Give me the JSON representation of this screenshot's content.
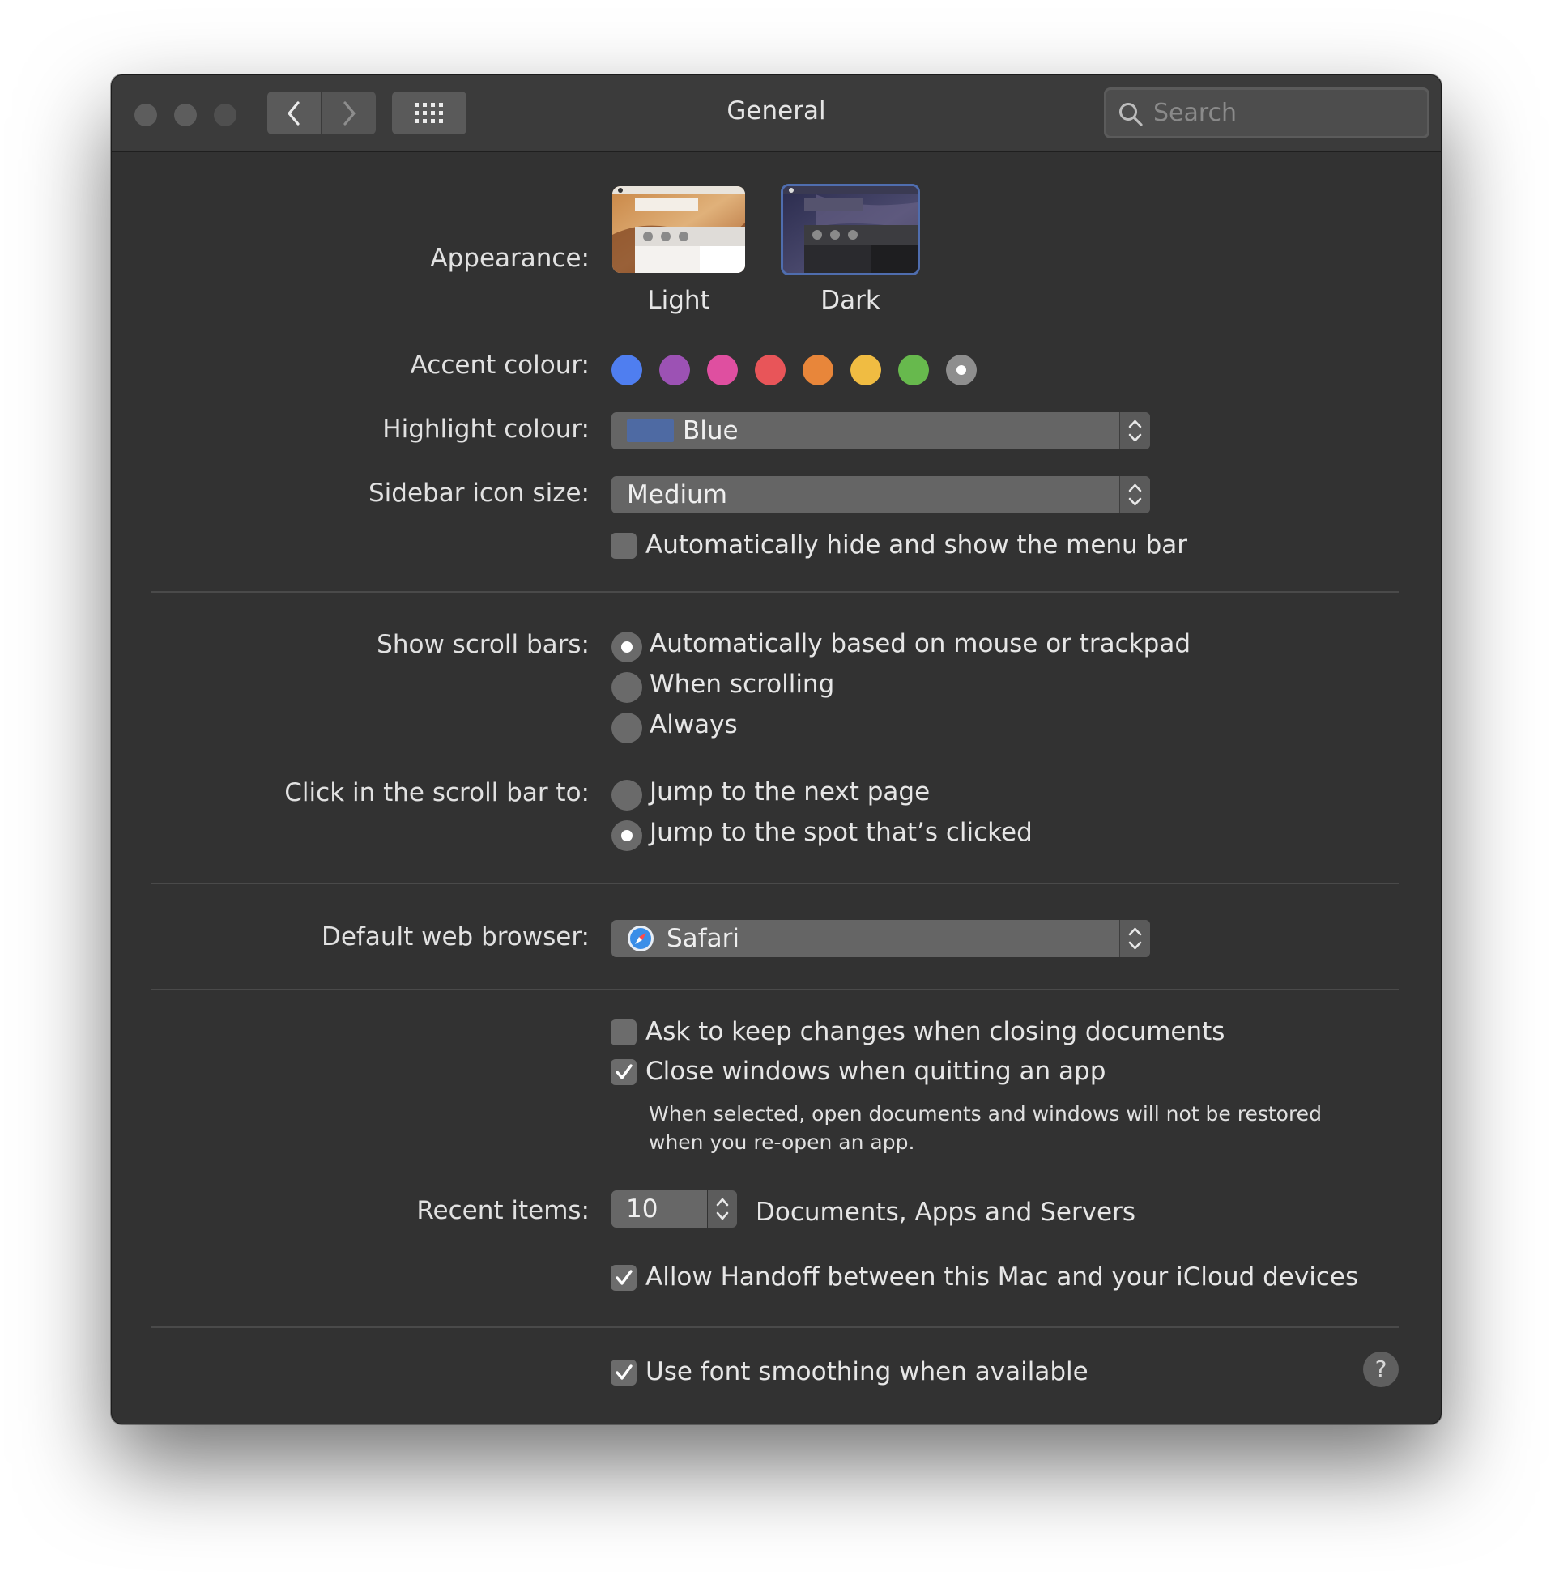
{
  "window": {
    "title": "General",
    "search_placeholder": "Search"
  },
  "appearance": {
    "label": "Appearance:",
    "options": [
      {
        "label": "Light",
        "selected": false
      },
      {
        "label": "Dark",
        "selected": true
      }
    ]
  },
  "accent": {
    "label": "Accent colour:",
    "colors": [
      "#4f7ef0",
      "#9c52b4",
      "#df4fa0",
      "#e85559",
      "#e8863a",
      "#f0bc42",
      "#67b94d",
      "#8e8e8e"
    ],
    "selected_index": 7
  },
  "highlight": {
    "label": "Highlight colour:",
    "value": "Blue",
    "swatch_color": "#4e6aa3"
  },
  "sidebar_icon": {
    "label": "Sidebar icon size:",
    "value": "Medium"
  },
  "auto_hide_menu": {
    "label": "Automatically hide and show the menu bar",
    "checked": false
  },
  "scroll_bars": {
    "label": "Show scroll bars:",
    "options": [
      {
        "label": "Automatically based on mouse or trackpad",
        "selected": true
      },
      {
        "label": "When scrolling",
        "selected": false
      },
      {
        "label": "Always",
        "selected": false
      }
    ]
  },
  "click_scroll": {
    "label": "Click in the scroll bar to:",
    "options": [
      {
        "label": "Jump to the next page",
        "selected": false
      },
      {
        "label": "Jump to the spot that’s clicked",
        "selected": true
      }
    ]
  },
  "browser": {
    "label": "Default web browser:",
    "value": "Safari"
  },
  "ask_keep_changes": {
    "label": "Ask to keep changes when closing documents",
    "checked": false
  },
  "close_windows": {
    "label": "Close windows when quitting an app",
    "checked": true,
    "note_line1": "When selected, open documents and windows will not be restored",
    "note_line2": "when you re-open an app."
  },
  "recent_items": {
    "label": "Recent items:",
    "value": "10",
    "suffix": "Documents, Apps and Servers"
  },
  "handoff": {
    "label": "Allow Handoff between this Mac and your iCloud devices",
    "checked": true
  },
  "font_smoothing": {
    "label": "Use font smoothing when available",
    "checked": true
  },
  "help": {
    "glyph": "?"
  }
}
